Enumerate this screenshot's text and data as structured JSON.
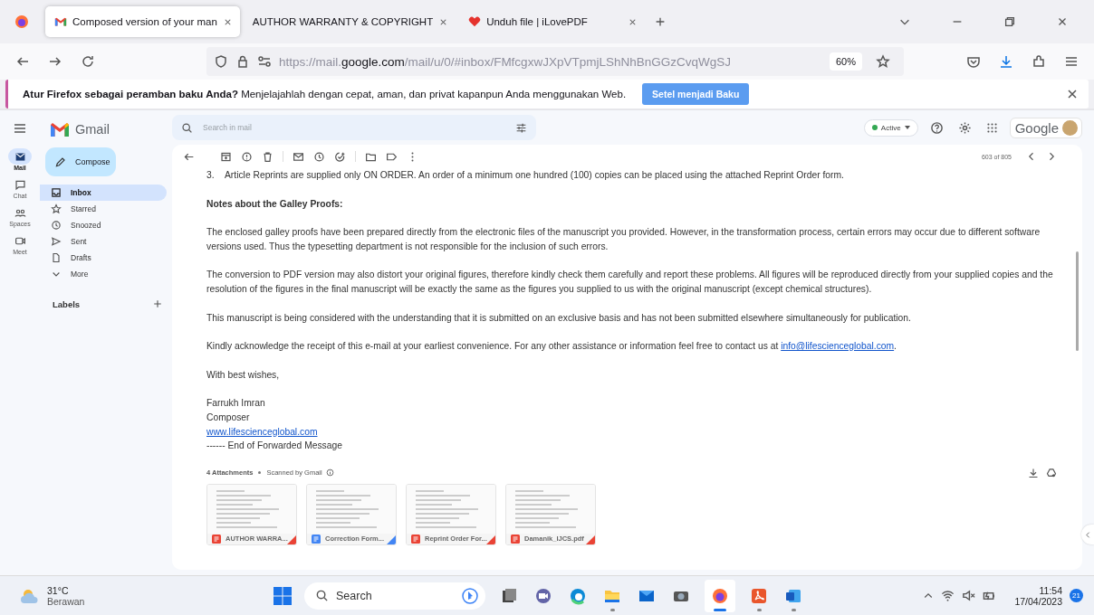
{
  "browser": {
    "tabs": [
      {
        "title": "Composed version of your man",
        "selected": true
      },
      {
        "title": "AUTHOR WARRANTY & COPYRIGHT",
        "selected": false
      },
      {
        "title": "Unduh file | iLovePDF",
        "selected": false
      }
    ],
    "url_prefix": "https://mail.",
    "url_domain": "google.com",
    "url_path": "/mail/u/0/#inbox/FMfcgxwJXpVTpmjLShNhBnGGzCvqWgSJ",
    "zoom": "60%",
    "notification": {
      "message": "**Atur Firefox sebagai peramban baku Anda?** Menjelajahlah dengan cepat, aman, dan privat kapanpun Anda menggunakan Web.",
      "button": "Setel menjadi Baku"
    }
  },
  "gmail": {
    "logo": "Gmail",
    "search": {
      "placeholder": "Search in mail"
    },
    "status": "Active",
    "account_logo": "Google",
    "rail": [
      {
        "label": "Mail",
        "selected": true
      },
      {
        "label": "Chat",
        "selected": false
      },
      {
        "label": "Spaces",
        "selected": false
      },
      {
        "label": "Meet",
        "selected": false
      }
    ],
    "compose": "Compose",
    "folders": [
      {
        "label": "Inbox",
        "selected": true
      },
      {
        "label": "Starred",
        "selected": false
      },
      {
        "label": "Snoozed",
        "selected": false
      },
      {
        "label": "Sent",
        "selected": false
      },
      {
        "label": "Drafts",
        "selected": false
      },
      {
        "label": "More",
        "selected": false
      }
    ],
    "labels_heading": "Labels",
    "counter": "603 of 805",
    "body": [
      {
        "kind": "numbered",
        "number": "3.",
        "text": "Article Reprints are supplied only ON ORDER. An order of a minimum one hundred (100) copies can be placed using the attached Reprint Order form."
      },
      {
        "kind": "heading",
        "text": "Notes about the Galley Proofs:"
      },
      {
        "kind": "text",
        "text": "The enclosed galley proofs have been prepared directly from the electronic files of the manuscript you provided. However, in the transformation process, certain errors may occur due to different software versions used. Thus the typesetting department is not responsible for the inclusion of such errors."
      },
      {
        "kind": "text",
        "text": "The conversion to PDF version may also distort your original figures, therefore kindly check them carefully and report these problems. All figures will be reproduced directly from your supplied copies and the resolution of the figures in the final manuscript will be exactly the same as the figures you supplied to us with the original manuscript (except chemical structures)."
      },
      {
        "kind": "text",
        "text": "This manuscript is being considered with the understanding that it is submitted on an exclusive basis and has not been submitted elsewhere simultaneously for publication."
      },
      {
        "kind": "link_text",
        "text": "Kindly acknowledge the receipt of this e-mail at your earliest convenience.  For any other assistance or information feel free to contact us at",
        "link": "info@lifescienceglobal.com",
        "tail": "."
      },
      {
        "kind": "text",
        "text": "With best wishes,"
      },
      {
        "kind": "signature",
        "lines": [
          {
            "kind": "text",
            "text": "Farrukh Imran"
          },
          {
            "kind": "text",
            "text": "Composer"
          },
          {
            "kind": "link",
            "text": "www.lifescienceglobal.com"
          },
          {
            "kind": "text",
            "text": "------ End of Forwarded Message"
          }
        ]
      }
    ],
    "attachments_title": "4 Attachments",
    "scanned": "Scanned by Gmail",
    "attachments": [
      {
        "kind": "pdf",
        "name": "AUTHOR WARRA..."
      },
      {
        "kind": "word",
        "name": "Correction Form..."
      },
      {
        "kind": "pdf",
        "name": "Reprint Order For..."
      },
      {
        "kind": "pdf",
        "name": "Damanik_IJCS.pdf"
      }
    ]
  },
  "taskbar": {
    "temperature": "31°C",
    "weather": "Berawan",
    "search": "Search",
    "apps": [
      {
        "running": false,
        "selected": false
      },
      {
        "running": false,
        "selected": false
      },
      {
        "running": false,
        "selected": false
      },
      {
        "running": true,
        "selected": false
      },
      {
        "running": false,
        "selected": false
      },
      {
        "running": false,
        "selected": false
      },
      {
        "running": true,
        "selected": true
      },
      {
        "running": true,
        "selected": false
      },
      {
        "running": true,
        "selected": false
      }
    ],
    "time": "11:54",
    "date": "17/04/2023",
    "notifications": "21"
  }
}
